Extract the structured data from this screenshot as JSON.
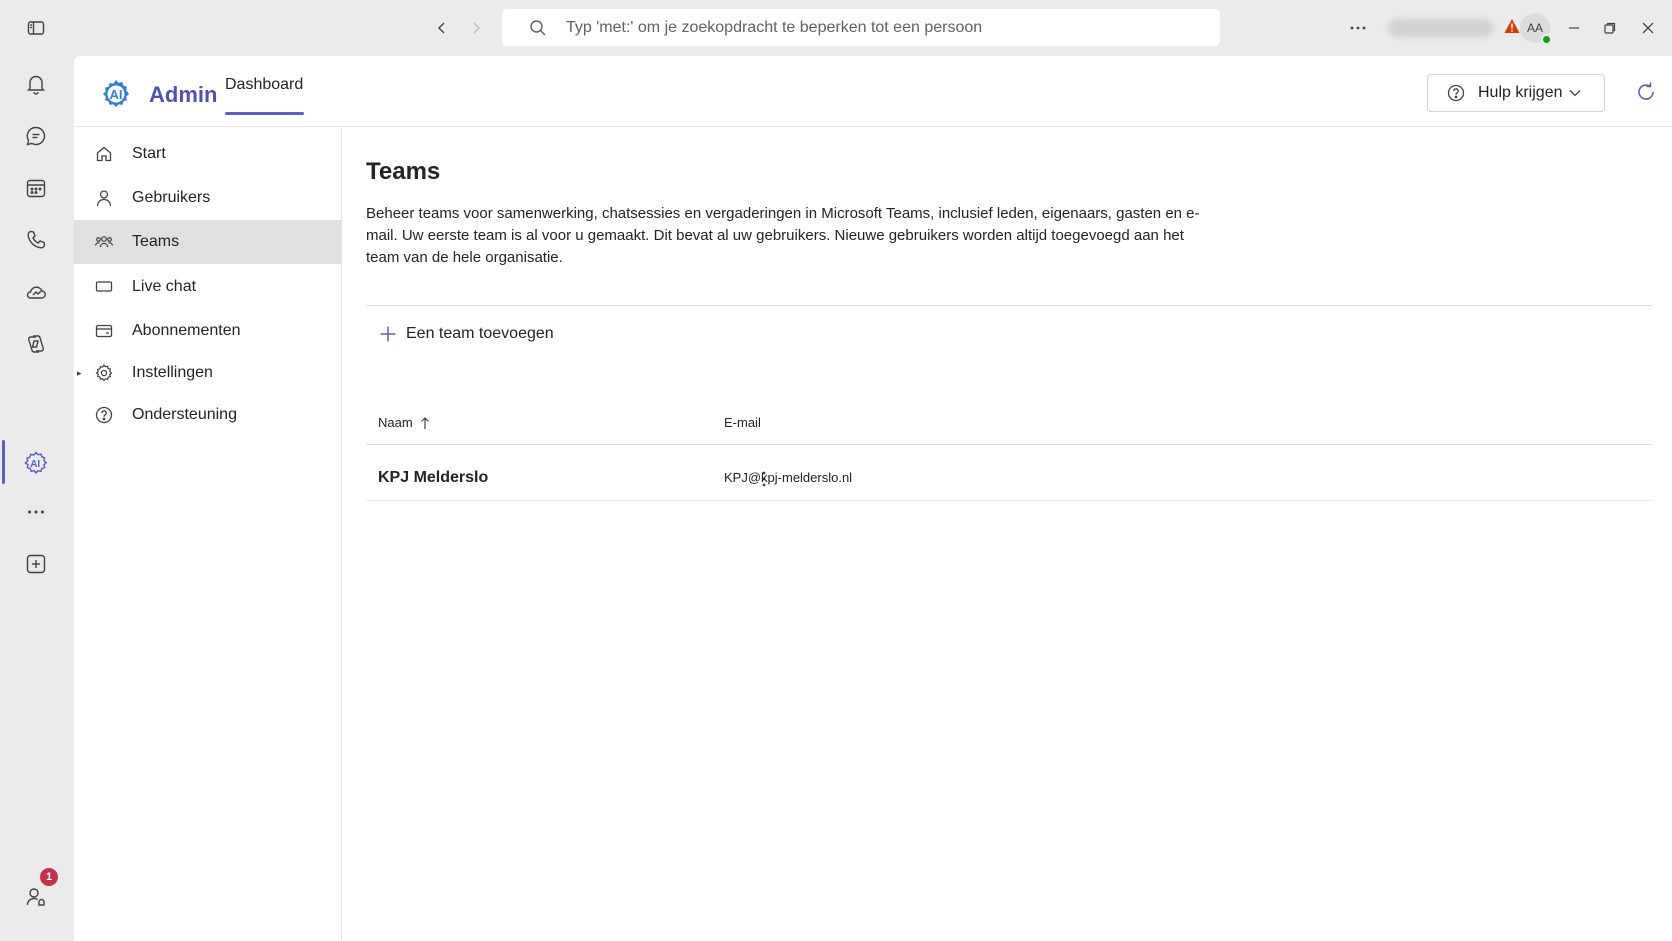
{
  "titlebar": {
    "search_placeholder": "Typ 'met:' om je zoekopdracht te beperken tot een persoon",
    "avatar_initials": "AA"
  },
  "rail": {
    "notification_badge": "1"
  },
  "app": {
    "name": "Admin",
    "tab_label": "Dashboard",
    "help_button_label": "Hulp krijgen"
  },
  "sidenav": {
    "items": [
      {
        "label": "Start"
      },
      {
        "label": "Gebruikers"
      },
      {
        "label": "Teams"
      },
      {
        "label": "Live chat"
      },
      {
        "label": "Abonnementen"
      },
      {
        "label": "Instellingen"
      },
      {
        "label": "Ondersteuning"
      }
    ]
  },
  "main": {
    "title": "Teams",
    "description": "Beheer teams voor samenwerking, chatsessies en vergaderingen in Microsoft Teams, inclusief leden, eigenaars, gasten en e-mail. Uw eerste team is al voor u gemaakt. Dit bevat al uw gebruikers. Nieuwe gebruikers worden altijd toegevoegd aan het team van de hele organisatie.",
    "add_team_label": "Een team toevoegen",
    "table": {
      "columns": [
        "Naam",
        "E-mail"
      ],
      "rows": [
        {
          "name": "KPJ Melderslo",
          "email": "KPJ@kpj-melderslo.nl"
        }
      ]
    }
  },
  "colors": {
    "accent": "#5b5fc7",
    "brand_text": "#4f52b2",
    "badge": "#c4314b",
    "warning": "#d83b01",
    "presence": "#13a10e"
  }
}
